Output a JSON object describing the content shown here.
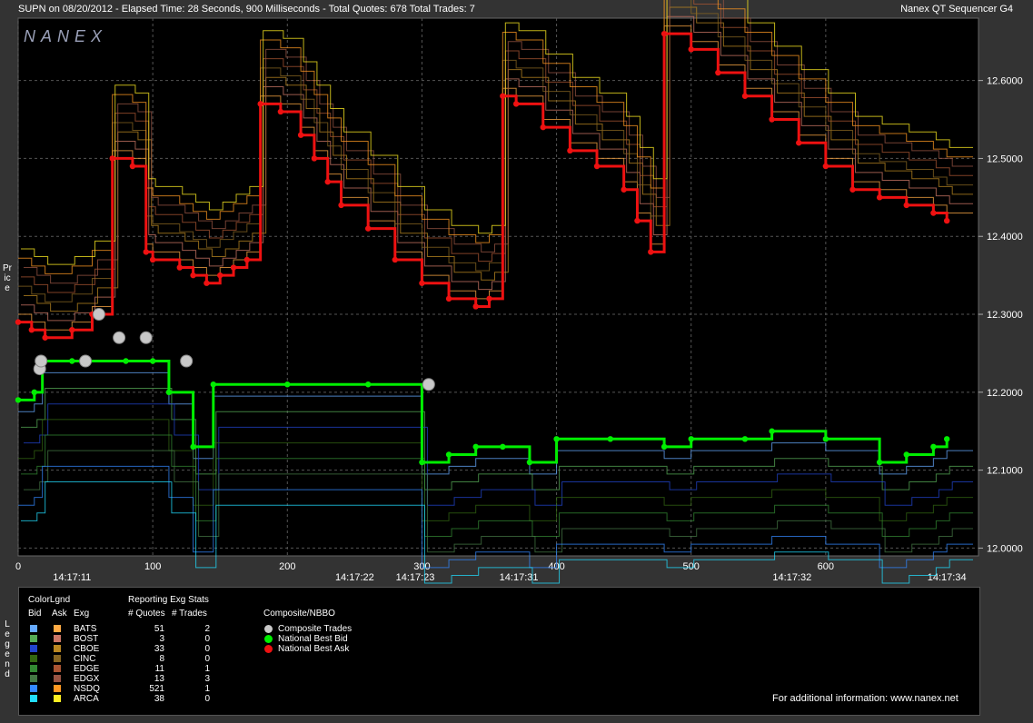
{
  "header": {
    "title": "SUPN on 08/20/2012  -  Elapsed Time: 28 Seconds, 900 Milliseconds  -  Total Quotes: 678  Total Trades: 7",
    "brand": "Nanex QT Sequencer G4",
    "logo": "NANEX"
  },
  "side": {
    "price_label": "Price",
    "legend_label": "Legend"
  },
  "colors": {
    "background": "#333333",
    "plot_bg": "#000000",
    "best_bid": "#00ee00",
    "best_ask": "#ee1111",
    "trade": "#c8c8c8"
  },
  "legend": {
    "color_legend_title": "ColorLgnd",
    "stats_title": "Reporting Exg Stats",
    "composite_title": "Composite/NBBO",
    "col_bid": "Bid",
    "col_ask": "Ask",
    "col_exg": "Exg",
    "col_quotes": "# Quotes",
    "col_trades": "# Trades",
    "exchanges": [
      {
        "name": "BATS",
        "quotes": "51",
        "trades": "2",
        "bid_color": "#66aaff",
        "ask_color": "#ffaa44"
      },
      {
        "name": "BOST",
        "quotes": "3",
        "trades": "0",
        "bid_color": "#55aa55",
        "ask_color": "#cc7766"
      },
      {
        "name": "CBOE",
        "quotes": "33",
        "trades": "0",
        "bid_color": "#2244cc",
        "ask_color": "#bb8822"
      },
      {
        "name": "CINC",
        "quotes": "8",
        "trades": "0",
        "bid_color": "#336611",
        "ask_color": "#886622"
      },
      {
        "name": "EDGE",
        "quotes": "11",
        "trades": "1",
        "bid_color": "#338833",
        "ask_color": "#aa5533"
      },
      {
        "name": "EDGX",
        "quotes": "13",
        "trades": "3",
        "bid_color": "#447744",
        "ask_color": "#995544"
      },
      {
        "name": "NSDQ",
        "quotes": "521",
        "trades": "1",
        "bid_color": "#3388ff",
        "ask_color": "#ff9922"
      },
      {
        "name": "ARCA",
        "quotes": "38",
        "trades": "0",
        "bid_color": "#22ddff",
        "ask_color": "#ffee22"
      }
    ],
    "composite": [
      {
        "label": "Composite Trades",
        "color": "#c8c8c8"
      },
      {
        "label": "National Best Bid",
        "color": "#00ee00"
      },
      {
        "label": "National Best Ask",
        "color": "#ee1111"
      }
    ],
    "footer": "For additional information: www.nanex.net"
  },
  "chart_data": {
    "type": "line",
    "xlabel": "",
    "ylabel": "Price",
    "xlim": [
      0,
      700
    ],
    "ylim": [
      11.99,
      12.68
    ],
    "x_ticks": [
      0,
      100,
      200,
      300,
      400,
      500,
      600
    ],
    "y_ticks": [
      "12.6000",
      "12.5000",
      "12.4000",
      "12.3000",
      "12.2000",
      "12.1000",
      "12.0000"
    ],
    "y_tick_values": [
      12.6,
      12.5,
      12.4,
      12.3,
      12.2,
      12.1,
      12.0
    ],
    "time_labels": [
      {
        "x": 40,
        "label": "14:17:11"
      },
      {
        "x": 250,
        "label": "14:17:22"
      },
      {
        "x": 295,
        "label": "14:17:23"
      },
      {
        "x": 372,
        "label": "14:17:31"
      },
      {
        "x": 575,
        "label": "14:17:32"
      },
      {
        "x": 690,
        "label": "14:17:34"
      }
    ],
    "series": [
      {
        "name": "National Best Ask",
        "color": "#ee1111",
        "x": [
          0,
          10,
          20,
          40,
          55,
          70,
          85,
          95,
          100,
          120,
          130,
          140,
          150,
          160,
          170,
          180,
          195,
          210,
          220,
          230,
          240,
          260,
          280,
          300,
          320,
          340,
          350,
          360,
          370,
          390,
          410,
          430,
          450,
          460,
          470,
          480,
          500,
          520,
          540,
          560,
          580,
          600,
          620,
          640,
          660,
          680,
          690
        ],
        "values": [
          12.29,
          12.28,
          12.27,
          12.28,
          12.3,
          12.5,
          12.49,
          12.38,
          12.37,
          12.36,
          12.35,
          12.34,
          12.35,
          12.36,
          12.37,
          12.57,
          12.56,
          12.53,
          12.5,
          12.47,
          12.44,
          12.41,
          12.37,
          12.34,
          12.32,
          12.31,
          12.32,
          12.58,
          12.57,
          12.54,
          12.51,
          12.49,
          12.46,
          12.42,
          12.38,
          12.66,
          12.64,
          12.61,
          12.58,
          12.55,
          12.52,
          12.49,
          12.46,
          12.45,
          12.44,
          12.43,
          12.42
        ]
      },
      {
        "name": "National Best Bid",
        "color": "#00ee00",
        "x": [
          0,
          12,
          18,
          40,
          80,
          100,
          112,
          130,
          145,
          200,
          260,
          300,
          320,
          340,
          360,
          380,
          400,
          440,
          480,
          500,
          540,
          560,
          600,
          640,
          660,
          680,
          690
        ],
        "values": [
          12.19,
          12.2,
          12.24,
          12.24,
          12.24,
          12.24,
          12.2,
          12.13,
          12.21,
          12.21,
          12.21,
          12.11,
          12.12,
          12.13,
          12.13,
          12.11,
          12.14,
          12.14,
          12.13,
          12.14,
          12.14,
          12.15,
          12.14,
          12.11,
          12.12,
          12.13,
          12.14
        ]
      },
      {
        "name": "Composite Trades",
        "color": "#c8c8c8",
        "x": [
          16,
          17,
          50,
          60,
          75,
          95,
          125,
          305
        ],
        "values": [
          12.23,
          12.24,
          12.24,
          12.3,
          12.27,
          12.27,
          12.24,
          12.21
        ]
      }
    ]
  }
}
